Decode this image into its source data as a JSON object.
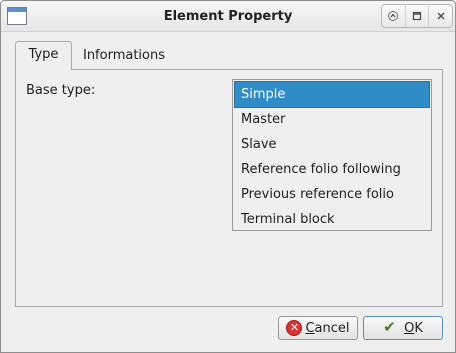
{
  "window": {
    "title": "Element Property",
    "controls": [
      "up-icon",
      "restore-icon",
      "close-icon"
    ]
  },
  "tabs": [
    {
      "label": "Type",
      "active": true
    },
    {
      "label": "Informations",
      "active": false
    }
  ],
  "form": {
    "base_type_label": "Base type:",
    "options": [
      {
        "label": "Simple",
        "selected": true
      },
      {
        "label": "Master",
        "selected": false
      },
      {
        "label": "Slave",
        "selected": false
      },
      {
        "label": "Reference folio following",
        "selected": false
      },
      {
        "label": "Previous reference folio",
        "selected": false
      },
      {
        "label": "Terminal block",
        "selected": false
      }
    ]
  },
  "buttons": {
    "cancel_first": "C",
    "cancel_rest": "ancel",
    "ok_first": "O",
    "ok_rest": "K"
  },
  "colors": {
    "selection": "#308cc6",
    "window_bg": "#efefef"
  }
}
